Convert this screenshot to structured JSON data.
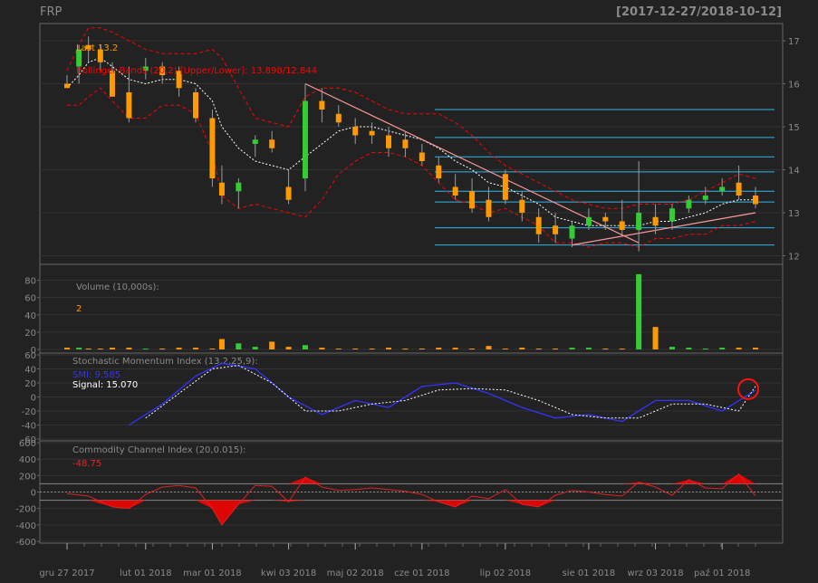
{
  "header": {
    "symbol": "FRP",
    "date_range": "[2017-12-27/2018-10-12]"
  },
  "colors": {
    "background": "#222222",
    "panel": "#222222",
    "border": "#666666",
    "grid": "#333333",
    "up": "#33cc33",
    "down": "#ff9900",
    "neutral": "#9a9a9a",
    "bbands": "#ff0000",
    "sma": "#ffffff",
    "hline": "#33b5e5",
    "trend": "#ff9999",
    "smi": "#3333ff",
    "signal": "#ffffff",
    "cci_line": "#dd2222",
    "cci_fill": "#ff0000",
    "label": "#8a8a8a",
    "last": "#ff9900",
    "bb_text": "#ff0000",
    "vol_text": "#ff9900",
    "marker": "#ff1111"
  },
  "chart_data": [
    {
      "type": "candlestick",
      "panel": "price",
      "x": [
        "2017-12-27",
        "2018-01-01",
        "2018-01-05",
        "2018-01-10",
        "2018-01-15",
        "2018-01-22",
        "2018-01-29",
        "2018-02-05",
        "2018-02-12",
        "2018-02-19",
        "2018-02-26",
        "2018-03-02",
        "2018-03-09",
        "2018-03-16",
        "2018-03-23",
        "2018-03-30",
        "2018-04-06",
        "2018-04-13",
        "2018-04-20",
        "2018-04-27",
        "2018-05-04",
        "2018-05-11",
        "2018-05-18",
        "2018-05-25",
        "2018-06-01",
        "2018-06-08",
        "2018-06-15",
        "2018-06-22",
        "2018-06-29",
        "2018-07-06",
        "2018-07-13",
        "2018-07-20",
        "2018-07-27",
        "2018-08-03",
        "2018-08-10",
        "2018-08-17",
        "2018-08-24",
        "2018-08-31",
        "2018-09-07",
        "2018-09-14",
        "2018-09-21",
        "2018-09-28",
        "2018-10-05",
        "2018-10-12"
      ],
      "open": [
        16.0,
        16.4,
        16.9,
        16.8,
        16.3,
        15.8,
        16.3,
        16.4,
        16.3,
        15.8,
        15.2,
        13.7,
        13.5,
        14.6,
        14.7,
        13.6,
        13.8,
        15.6,
        15.3,
        15.0,
        14.9,
        14.8,
        14.7,
        14.4,
        14.1,
        13.6,
        13.5,
        13.3,
        13.9,
        13.3,
        12.9,
        12.7,
        12.4,
        12.7,
        12.9,
        12.8,
        12.6,
        12.9,
        12.8,
        13.1,
        13.3,
        13.5,
        13.7,
        13.4
      ],
      "high": [
        16.2,
        16.9,
        17.1,
        16.9,
        16.5,
        16.4,
        16.6,
        16.5,
        16.4,
        15.9,
        15.4,
        14.1,
        13.8,
        14.8,
        14.9,
        14.0,
        16.0,
        15.9,
        15.5,
        15.2,
        15.1,
        15.0,
        14.9,
        14.6,
        14.3,
        13.9,
        13.8,
        13.6,
        14.0,
        13.5,
        13.1,
        13.0,
        12.8,
        13.1,
        13.0,
        13.3,
        14.2,
        13.2,
        13.2,
        13.4,
        13.6,
        13.8,
        14.1,
        13.6
      ],
      "low": [
        15.9,
        16.0,
        16.5,
        16.3,
        15.7,
        15.1,
        16.1,
        16.0,
        15.7,
        15.1,
        13.6,
        13.2,
        13.1,
        14.3,
        14.4,
        13.2,
        13.5,
        15.1,
        15.0,
        14.6,
        14.6,
        14.3,
        14.3,
        14.1,
        13.7,
        13.3,
        13.0,
        12.8,
        13.2,
        12.8,
        12.3,
        12.3,
        12.2,
        12.6,
        12.6,
        12.5,
        12.1,
        12.5,
        12.6,
        13.0,
        13.2,
        13.4,
        13.3,
        13.1
      ],
      "close": [
        15.9,
        16.8,
        16.8,
        16.5,
        15.7,
        15.2,
        16.4,
        16.2,
        15.9,
        15.2,
        13.8,
        13.4,
        13.7,
        14.7,
        14.5,
        13.3,
        15.6,
        15.4,
        15.1,
        14.8,
        14.8,
        14.5,
        14.5,
        14.2,
        13.8,
        13.4,
        13.1,
        12.9,
        13.3,
        13.0,
        12.5,
        12.5,
        12.7,
        12.9,
        12.8,
        12.6,
        13.0,
        12.7,
        13.1,
        13.3,
        13.4,
        13.6,
        13.4,
        13.2
      ],
      "sma": [
        15.9,
        16.2,
        16.5,
        16.6,
        16.4,
        16.1,
        16.0,
        16.1,
        16.1,
        16.0,
        15.6,
        15.0,
        14.5,
        14.2,
        14.1,
        14.0,
        14.3,
        14.6,
        14.9,
        15.0,
        15.0,
        14.9,
        14.8,
        14.7,
        14.5,
        14.2,
        14.0,
        13.7,
        13.6,
        13.4,
        13.2,
        12.9,
        12.8,
        12.7,
        12.7,
        12.7,
        12.7,
        12.8,
        12.8,
        12.9,
        13.0,
        13.2,
        13.3,
        13.3
      ],
      "bb_upper": [
        16.3,
        16.9,
        17.3,
        17.3,
        17.2,
        17.0,
        16.8,
        16.7,
        16.7,
        16.7,
        16.8,
        16.6,
        15.9,
        15.2,
        15.1,
        15.0,
        15.7,
        15.9,
        15.9,
        15.8,
        15.6,
        15.4,
        15.3,
        15.3,
        15.3,
        15.1,
        14.8,
        14.4,
        14.1,
        13.9,
        13.7,
        13.5,
        13.3,
        13.2,
        13.1,
        13.1,
        13.2,
        13.2,
        13.2,
        13.3,
        13.5,
        13.7,
        13.9,
        13.8
      ],
      "bb_lower": [
        15.5,
        15.5,
        15.7,
        15.9,
        15.6,
        15.2,
        15.2,
        15.5,
        15.5,
        15.3,
        14.4,
        13.4,
        13.1,
        13.2,
        13.1,
        13.0,
        12.9,
        13.3,
        13.9,
        14.2,
        14.4,
        14.4,
        14.3,
        14.1,
        13.7,
        13.3,
        13.2,
        13.0,
        13.1,
        12.9,
        12.7,
        12.3,
        12.3,
        12.2,
        12.3,
        12.3,
        12.2,
        12.4,
        12.4,
        12.5,
        12.5,
        12.7,
        12.7,
        12.8
      ],
      "hlines": [
        15.4,
        14.75,
        14.3,
        13.95,
        13.5,
        13.25,
        12.65,
        12.25
      ],
      "trendlines": [
        {
          "from": {
            "x": "2018-04-06",
            "y": 16.0
          },
          "to": {
            "x": "2018-08-24",
            "y": 12.3
          }
        },
        {
          "from": {
            "x": "2018-07-27",
            "y": 12.25
          },
          "to": {
            "x": "2018-10-12",
            "y": 13.0
          }
        }
      ],
      "ylim": [
        11.8,
        17.4
      ],
      "yticks": [
        12,
        13,
        14,
        15,
        16,
        17
      ],
      "legend": {
        "last": "Last 13.2",
        "bbands": "Bollinger Bands (20,2) [Upper/Lower]: 13.898/12.844"
      }
    },
    {
      "type": "bar",
      "panel": "volume",
      "title": "Volume (10,000s):",
      "last_value": "2",
      "x": [
        "2017-12-27",
        "2018-01-01",
        "2018-01-05",
        "2018-01-10",
        "2018-01-15",
        "2018-01-22",
        "2018-01-29",
        "2018-02-05",
        "2018-02-12",
        "2018-02-19",
        "2018-02-26",
        "2018-03-02",
        "2018-03-09",
        "2018-03-16",
        "2018-03-23",
        "2018-03-30",
        "2018-04-06",
        "2018-04-13",
        "2018-04-20",
        "2018-04-27",
        "2018-05-04",
        "2018-05-11",
        "2018-05-18",
        "2018-05-25",
        "2018-06-01",
        "2018-06-08",
        "2018-06-15",
        "2018-06-22",
        "2018-06-29",
        "2018-07-06",
        "2018-07-13",
        "2018-07-20",
        "2018-07-27",
        "2018-08-03",
        "2018-08-10",
        "2018-08-17",
        "2018-08-24",
        "2018-08-31",
        "2018-09-07",
        "2018-09-14",
        "2018-09-21",
        "2018-09-28",
        "2018-10-05",
        "2018-10-12"
      ],
      "values": [
        2,
        2,
        1,
        1,
        2,
        2,
        1,
        1,
        2,
        2,
        1,
        12,
        7,
        3,
        9,
        3,
        5,
        2,
        1,
        1,
        1,
        2,
        1,
        1,
        2,
        2,
        1,
        4,
        1,
        2,
        1,
        1,
        2,
        2,
        1,
        1,
        87,
        26,
        3,
        2,
        1,
        2,
        2,
        2
      ],
      "ylim": [
        0,
        90
      ],
      "yticks": [
        0,
        20,
        40,
        60,
        80
      ]
    },
    {
      "type": "line",
      "panel": "smi",
      "title": "Stochastic Momentum Index (13,2,25,9):",
      "series": [
        {
          "name": "SMI",
          "label": "SMI: 9.585",
          "x": [
            "2018-01-22",
            "2018-02-05",
            "2018-02-19",
            "2018-03-02",
            "2018-03-16",
            "2018-03-30",
            "2018-04-13",
            "2018-04-27",
            "2018-05-11",
            "2018-05-25",
            "2018-06-08",
            "2018-06-22",
            "2018-07-06",
            "2018-07-20",
            "2018-08-03",
            "2018-08-17",
            "2018-08-31",
            "2018-09-14",
            "2018-09-28",
            "2018-10-12"
          ],
          "values": [
            -40,
            -10,
            30,
            48,
            40,
            0,
            -25,
            -5,
            -15,
            15,
            20,
            5,
            -15,
            -30,
            -25,
            -35,
            -5,
            -5,
            -20,
            9.585
          ]
        },
        {
          "name": "Signal",
          "label": "Signal: 15.070",
          "x": [
            "2018-01-29",
            "2018-02-12",
            "2018-02-26",
            "2018-03-09",
            "2018-03-23",
            "2018-04-06",
            "2018-04-20",
            "2018-05-04",
            "2018-05-18",
            "2018-06-01",
            "2018-06-15",
            "2018-06-29",
            "2018-07-13",
            "2018-07-27",
            "2018-08-10",
            "2018-08-24",
            "2018-09-07",
            "2018-09-21",
            "2018-10-05",
            "2018-10-12"
          ],
          "values": [
            -30,
            5,
            40,
            45,
            20,
            -20,
            -20,
            -10,
            -5,
            10,
            12,
            10,
            -5,
            -25,
            -30,
            -30,
            -10,
            -10,
            -20,
            15.07
          ]
        }
      ],
      "ylim": [
        -60,
        60
      ],
      "yticks": [
        -60,
        -40,
        -20,
        0,
        20,
        40,
        60
      ]
    },
    {
      "type": "area",
      "panel": "cci",
      "title": "Commodity Channel Index (20,0.015):",
      "last_value": "-48.75",
      "x": [
        "2017-12-27",
        "2018-01-05",
        "2018-01-15",
        "2018-01-22",
        "2018-01-29",
        "2018-02-05",
        "2018-02-12",
        "2018-02-19",
        "2018-02-26",
        "2018-03-02",
        "2018-03-09",
        "2018-03-16",
        "2018-03-23",
        "2018-03-30",
        "2018-04-06",
        "2018-04-13",
        "2018-04-20",
        "2018-04-27",
        "2018-05-04",
        "2018-05-11",
        "2018-05-18",
        "2018-05-25",
        "2018-06-01",
        "2018-06-08",
        "2018-06-15",
        "2018-06-22",
        "2018-06-29",
        "2018-07-06",
        "2018-07-13",
        "2018-07-20",
        "2018-07-27",
        "2018-08-03",
        "2018-08-10",
        "2018-08-17",
        "2018-08-24",
        "2018-08-31",
        "2018-09-07",
        "2018-09-14",
        "2018-09-21",
        "2018-09-28",
        "2018-10-05",
        "2018-10-12"
      ],
      "values": [
        -20,
        -50,
        -180,
        -200,
        -30,
        60,
        80,
        50,
        -200,
        -400,
        -150,
        80,
        70,
        -120,
        180,
        60,
        20,
        30,
        50,
        30,
        10,
        -30,
        -120,
        -180,
        -50,
        -80,
        30,
        -150,
        -180,
        -40,
        20,
        0,
        -30,
        -50,
        120,
        60,
        -40,
        150,
        50,
        40,
        220,
        -48.75
      ],
      "hlines": [
        100,
        0,
        -100
      ],
      "ylim": [
        -600,
        600
      ],
      "yticks": [
        -600,
        -400,
        -200,
        0,
        200,
        400,
        600
      ]
    }
  ],
  "xaxis": {
    "ticks": [
      "gru 27 2017",
      "lut 01 2018",
      "mar 01 2018",
      "kwi 03 2018",
      "maj 02 2018",
      "cze 01 2018",
      "lip 02 2018",
      "sie 01 2018",
      "wrz 03 2018",
      "paź 01 2018"
    ],
    "tick_dates": [
      "2017-12-27",
      "2018-01-29",
      "2018-02-26",
      "2018-03-30",
      "2018-04-27",
      "2018-05-25",
      "2018-06-29",
      "2018-08-03",
      "2018-08-31",
      "2018-09-28"
    ],
    "range": [
      "2017-12-27",
      "2018-10-12"
    ]
  }
}
